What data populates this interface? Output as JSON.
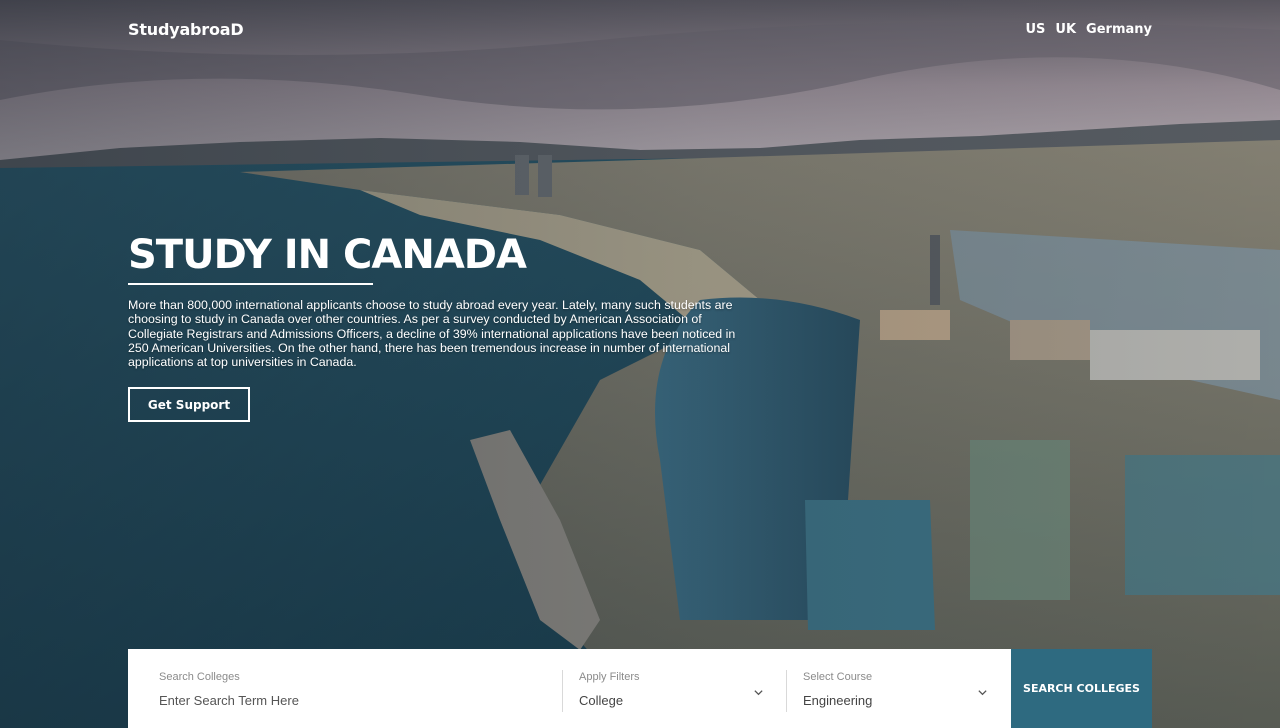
{
  "brand": {
    "logo": "StudyabroaD"
  },
  "nav": {
    "items": [
      "US",
      "UK",
      "Germany"
    ]
  },
  "hero": {
    "title": "STUDY IN CANADA",
    "description": "More than 800,000 international applicants choose to study abroad every year. Lately, many such students are choosing to study in Canada over other countries. As per a survey conducted by American Association of Collegiate Registrars and Admissions Officers, a decline of 39% international applications have been noticed in 250 American Universities. On the other hand, there has been tremendous increase in number of international applications at top universities in Canada.",
    "cta": "Get Support"
  },
  "search": {
    "colleges_label": "Search Colleges",
    "colleges_placeholder": "Enter Search Term Here",
    "filters_label": "Apply Filters",
    "filters_value": "College",
    "course_label": "Select Course",
    "course_value": "Engineering",
    "button": "SEARCH COLLEGES"
  },
  "colors": {
    "accent": "#2e6a80",
    "text_on_hero": "#ffffff"
  }
}
